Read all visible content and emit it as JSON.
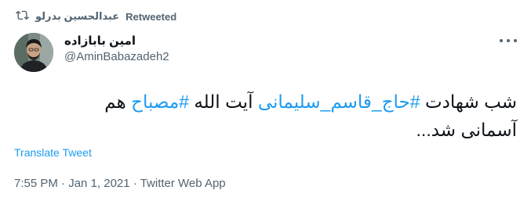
{
  "retweet": {
    "icon": "retweet-icon",
    "user": "عبدالحسین بدرلو",
    "label": "Retweeted"
  },
  "author": {
    "display_name": "امین بابازاده",
    "handle": "@AminBabazadeh2",
    "avatar": "profile-photo"
  },
  "menu": {
    "icon": "more-options-icon"
  },
  "tweet": {
    "seg1": "شب شهادت ",
    "tag1": "#حاج_قاسم_سلیمانی",
    "seg2": " آیت الله ",
    "tag2": "#مصباح",
    "seg3": " هم آسمانی شد..."
  },
  "translate_label": "Translate Tweet",
  "meta": {
    "time": "7:55 PM",
    "sep1": " · ",
    "date": "Jan 1, 2021",
    "sep2": " · ",
    "source": "Twitter Web App"
  },
  "colors": {
    "link": "#1d9bf0",
    "secondary": "#536471",
    "text": "#0f1419"
  }
}
